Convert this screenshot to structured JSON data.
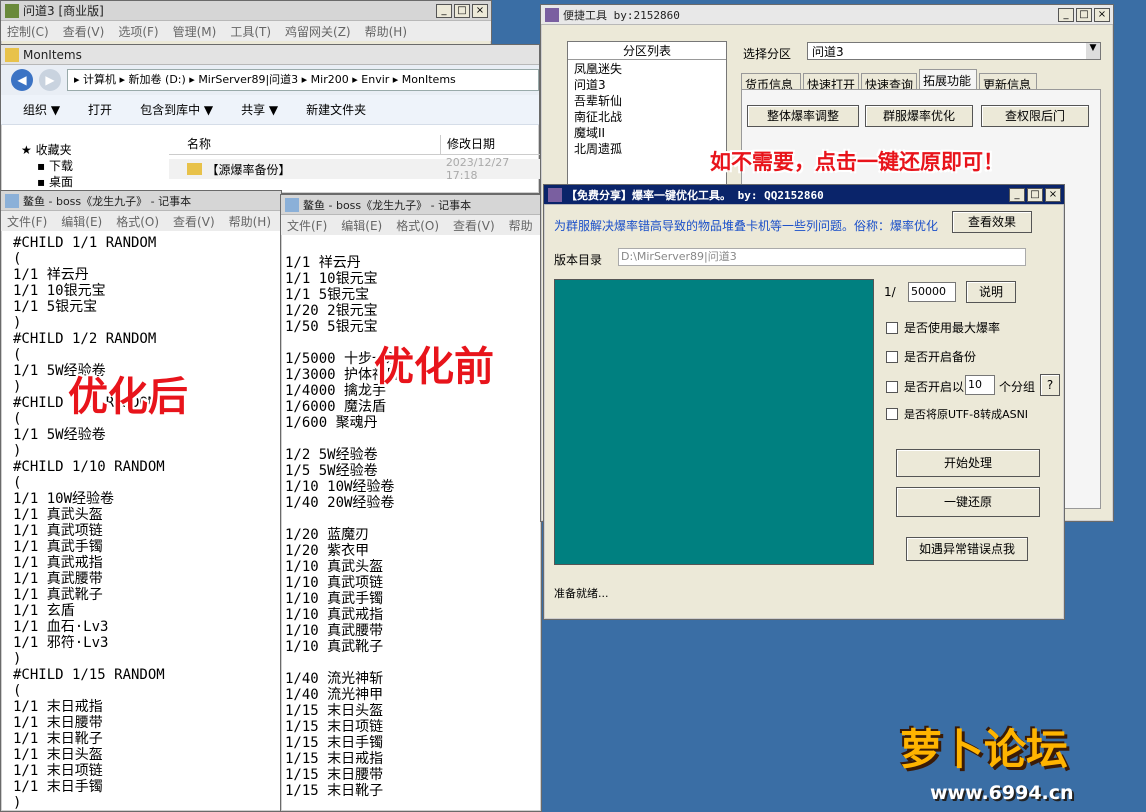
{
  "mir_window": {
    "title": "问道3 [商业版]",
    "menu": [
      "控制(C)",
      "查看(V)",
      "选项(F)",
      "管理(M)",
      "工具(T)",
      "鸡留网关(Z)",
      "帮助(H)"
    ]
  },
  "explorer": {
    "title": "MonItems",
    "breadcrumb": [
      "计算机",
      "新加卷 (D:)",
      "MirServer89|问道3",
      "Mir200",
      "Envir",
      "MonItems"
    ],
    "toolbar": [
      "组织 ▼",
      "打开",
      "包含到库中 ▼",
      "共享 ▼",
      "新建文件夹"
    ],
    "nav": [
      "收藏夹",
      "下载",
      "桌面"
    ],
    "columns": [
      "名称",
      "修改日期"
    ],
    "file": {
      "name": "【源爆率备份】",
      "date": "2023/12/27 17:18"
    }
  },
  "notepad_after": {
    "title": "鳌鱼 - boss《龙生九子》 - 记事本",
    "menu": [
      "文件(F)",
      "编辑(E)",
      "格式(O)",
      "查看(V)",
      "帮助(H)"
    ],
    "content": "#CHILD 1/1 RANDOM\n(\n1/1 祥云丹\n1/1 10银元宝\n1/1 5银元宝\n)\n#CHILD 1/2 RANDOM\n(\n1/1 5W经验卷\n)\n#CHILD 1/5 RANDOM\n(\n1/1 5W经验卷\n)\n#CHILD 1/10 RANDOM\n(\n1/1 10W经验卷\n1/1 真武头盔\n1/1 真武项链\n1/1 真武手镯\n1/1 真武戒指\n1/1 真武腰带\n1/1 真武靴子\n1/1 玄盾\n1/1 血石·Lv3\n1/1 邪符·Lv3\n)\n#CHILD 1/15 RANDOM\n(\n1/1 末日戒指\n1/1 末日腰带\n1/1 末日靴子\n1/1 末日头盔\n1/1 末日项链\n1/1 末日手镯\n)",
    "label": "优化后"
  },
  "notepad_before": {
    "title": "鳌鱼 - boss《龙生九子》 - 记事本",
    "menu": [
      "文件(F)",
      "编辑(E)",
      "格式(O)",
      "查看(V)",
      "帮助"
    ],
    "content": "\n1/1 祥云丹\n1/1 10银元宝\n1/1 5银元宝\n1/20 2银元宝\n1/50 5银元宝\n\n1/5000 十步一杀\n1/3000 护体神盾\n1/4000 擒龙手\n1/6000 魔法盾\n1/600 聚魂丹\n\n1/2 5W经验卷\n1/5 5W经验卷\n1/10 10W经验卷\n1/40 20W经验卷\n\n1/20 蓝魔刃\n1/20 紫衣甲\n1/10 真武头盔\n1/10 真武项链\n1/10 真武手镯\n1/10 真武戒指\n1/10 真武腰带\n1/10 真武靴子\n\n1/40 流光神斩\n1/40 流光神甲\n1/15 末日头盔\n1/15 末日项链\n1/15 末日手镯\n1/15 末日戒指\n1/15 末日腰带\n1/15 末日靴子",
    "label": "优化前"
  },
  "quicktool": {
    "title": "便捷工具   by:2152860",
    "list_header": "分区列表",
    "list_items": [
      "凤凰迷失",
      "问道3",
      "吾辈斩仙",
      "南征北战",
      "魔域II",
      "北周遗孤"
    ],
    "select_label": "选择分区",
    "select_value": "问道3",
    "tabs": [
      "货币信息",
      "快速打开",
      "快速查询",
      "拓展功能",
      "更新信息"
    ],
    "buttons": [
      "整体爆率调整",
      "群服爆率优化",
      "查权限后门"
    ],
    "notice": "如不需要，点击一键还原即可！"
  },
  "optimizer": {
    "title": "【免费分享】爆率一键优化工具。    by: QQ2152860",
    "desc": "为群服解决爆率错高导致的物品堆叠卡机等一些列问题。俗称：爆率优化",
    "view_button": "查看效果",
    "dir_label": "版本目录",
    "dir_value": "D:\\MirServer89|问道3",
    "rate_prefix": "1/",
    "rate_value": "50000",
    "explain_button": "说明",
    "options": [
      "是否使用最大爆率",
      "是否开启备份",
      "是否开启以",
      "是否将原UTF-8转成ASNI"
    ],
    "group_value": "10",
    "group_suffix": "个分组",
    "help_button": "?",
    "start_button": "开始处理",
    "restore_button": "一键还原",
    "error_button": "如遇异常错误点我",
    "status": "准备就绪..."
  },
  "watermark": {
    "logo": "萝卜论坛",
    "url": "www.6994.cn"
  },
  "colors": {
    "teal": "#008080",
    "accent_red": "#e8141b",
    "title_active": "#0a246a"
  }
}
